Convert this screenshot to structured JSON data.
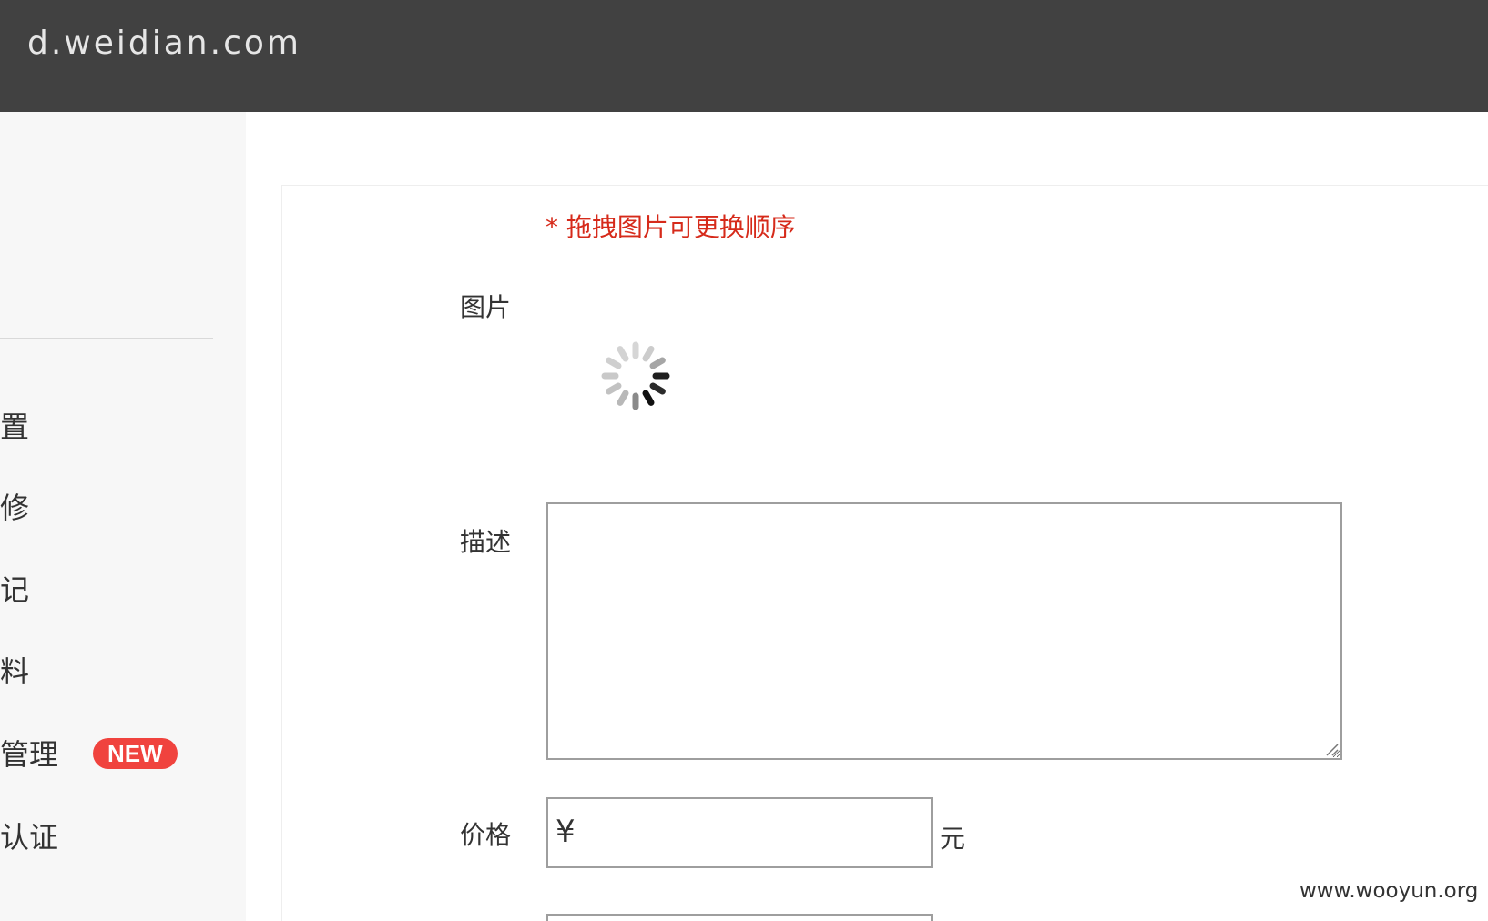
{
  "header": {
    "logo_text": "d.weidian.com",
    "background_color": "#414141"
  },
  "sidebar": {
    "items": [
      {
        "label": "置",
        "badge": ""
      },
      {
        "label": "修",
        "badge": ""
      },
      {
        "label": "记",
        "badge": ""
      },
      {
        "label": "料",
        "badge": ""
      },
      {
        "label": "管理",
        "badge": "NEW"
      },
      {
        "label": "认证",
        "badge": ""
      }
    ],
    "badge_color": "#f0433e"
  },
  "form": {
    "drag_hint": "* 拖拽图片可更换顺序",
    "hint_color": "#d62a1a",
    "image_label": "图片",
    "image_state_icon": "loading-spinner",
    "description_label": "描述",
    "description_value": "",
    "price_label": "价格",
    "price_currency": "¥",
    "price_value": "",
    "price_unit": "元"
  },
  "watermark": {
    "text": "www.wooyun.org"
  }
}
